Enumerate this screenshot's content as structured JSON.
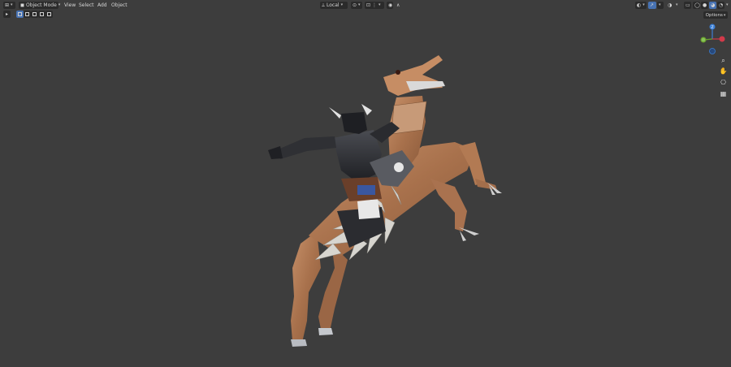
{
  "header": {
    "mode_label": "Object Mode",
    "menus": [
      "View",
      "Select",
      "Add",
      "Object"
    ],
    "transform_orientation": "Local"
  },
  "options_label": "Options",
  "gizmo": {
    "axis_z": "Z",
    "axis_y": "Y",
    "axis_x": "X"
  },
  "colors": {
    "viewport_bg": "#3d3d3d",
    "header_bg": "#3d3d3d",
    "button_bg": "#2b2b2b",
    "accent_blue": "#4772b3",
    "axis_x": "#d23a4a",
    "axis_y": "#6aa12d",
    "axis_z": "#3b7fd6"
  },
  "icons": [
    "editor-type-icon",
    "object-mode-icon",
    "select-mode-icons",
    "pivot-icon",
    "snap-icon",
    "proportional-edit-icon",
    "visibility-icon",
    "gizmo-icon",
    "overlay-icon",
    "xray-icon",
    "shading-solid-icon",
    "shading-material-icon",
    "shading-rendered-icon",
    "zoom-icon",
    "hand-icon",
    "camera-icon",
    "grid-icon"
  ]
}
